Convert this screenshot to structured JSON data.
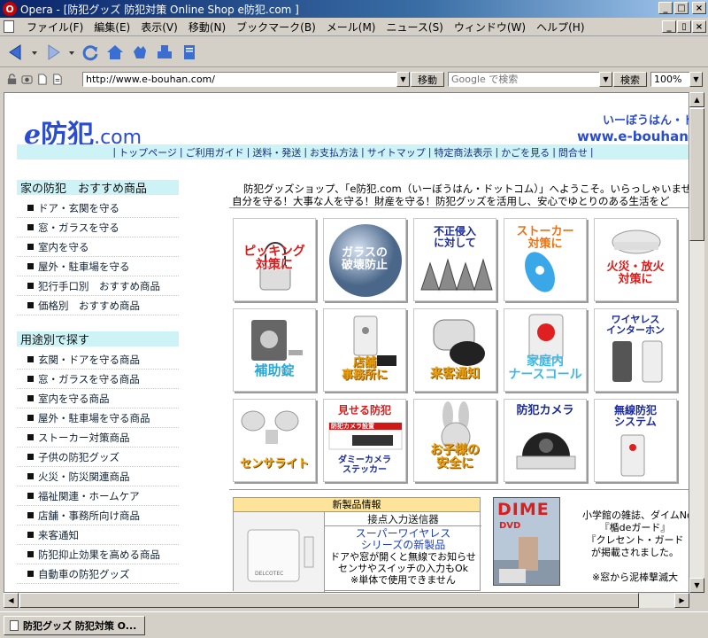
{
  "window": {
    "title": "Opera - [防犯グッズ 防犯対策 Online Shop e防犯.com ]",
    "icon_letter": "O",
    "minimize": "_",
    "maximize": "□",
    "close": "×"
  },
  "menu": {
    "items": [
      "ファイル(F)",
      "編集(E)",
      "表示(V)",
      "移動(N)",
      "ブックマーク(B)",
      "メール(M)",
      "ニュース(S)",
      "ウィンドウ(W)",
      "ヘルプ(H)"
    ],
    "restore": "▯"
  },
  "address": {
    "url": "http://www.e-bouhan.com/",
    "go_label": "移動",
    "search_placeholder": "Google で検索",
    "search_button": "検索",
    "zoom": "100%"
  },
  "site": {
    "logo_e": "e",
    "logo_main": "防犯",
    "logo_dot": ".com",
    "reading": "いーぼうはん・ド",
    "url": "www.e-bouhan",
    "nav": [
      "トップページ",
      "ご利用ガイド",
      "送料・発送",
      "お支払方法",
      "サイトマップ",
      "特定商法表示",
      "かごを見る",
      "問合せ"
    ],
    "nav_sep": "|"
  },
  "sidebar": {
    "section1": {
      "title": "家の防犯　おすすめ商品",
      "items": [
        "ドア・玄関を守る",
        "窓・ガラスを守る",
        "室内を守る",
        "屋外・駐車場を守る",
        "犯行手口別　おすすめ商品",
        "価格別　おすすめ商品"
      ]
    },
    "section2": {
      "title": "用途別で探す",
      "items": [
        "玄関・ドアを守る商品",
        "窓・ガラスを守る商品",
        "室内を守る商品",
        "屋外・駐車場を守る商品",
        "ストーカー対策商品",
        "子供の防犯グッズ",
        "火災・防災関連商品",
        "福祉関連・ホームケア",
        "店舗・事務所向け商品",
        "来客通知",
        "防犯抑止効果を高める商品",
        "自動車の防犯グッズ"
      ]
    }
  },
  "welcome": {
    "line1": "防犯グッズショップ、「e防犯.com（いーぼうはん・ドットコム）」へようこそ。いらっしゃいませ。",
    "line2": "自分を守る！大事な人を守る！財産を守る！防犯グッズを活用し、安心でゆとりのある生活をど"
  },
  "tiles": [
    {
      "label": "ピッキング\n対策に"
    },
    {
      "label": "ガラスの\n破壊防止"
    },
    {
      "label": "不正侵入\nに対して"
    },
    {
      "label": "ストーカー\n対策に"
    },
    {
      "label": "火災・放火\n対策に"
    },
    {
      "label": "補助錠"
    },
    {
      "label": "店舗\n事務所に"
    },
    {
      "label": "来客通知"
    },
    {
      "label": "家庭内\nナースコール"
    },
    {
      "label": "ワイヤレス\nインターホン"
    },
    {
      "label": "センサライト"
    },
    {
      "label": "見せる防犯",
      "sub": "ダミーカメラ\nステッカー",
      "tag": "防犯カメラ設置"
    },
    {
      "label": "お子様の\n安全に"
    },
    {
      "label": "防犯カメラ"
    },
    {
      "label": "無線防犯\nシステム"
    }
  ],
  "news": {
    "header": "新製品情報",
    "title": "接点入力送信器",
    "lines": [
      "スーパーワイヤレス",
      "シリーズの新製品",
      "ドアや窓が開くと無線でお知らせ",
      "センサやスイッチの入力もOk",
      "※単体で使用できません"
    ],
    "device_brand": "DELCOTEC"
  },
  "magazine": {
    "logo": "DIME",
    "badge": "DVD",
    "press_lines": [
      "小学館の雑誌、ダイムNo",
      "『楯deガード』",
      "『クレセント・ガード",
      "が掲載されました。",
      "",
      "※窓から泥棒撃滅大"
    ]
  },
  "status": {
    "tab": "防犯グッズ 防犯対策 O..."
  },
  "colors": {
    "brand_blue": "#2a4cd0",
    "nav_bg": "#cdf3f7",
    "news_header_bg": "#fde49a"
  }
}
